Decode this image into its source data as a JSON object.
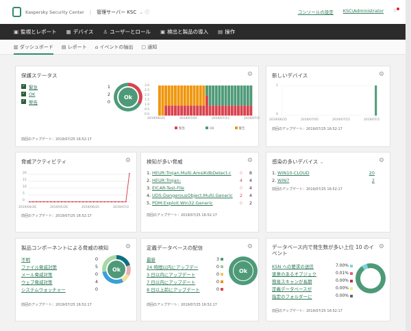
{
  "header": {
    "brand": "Kaspersky Security Center",
    "server": "管理サーバー KSC",
    "console_settings": "コンソールの設定",
    "user": "KSC\\Administrator"
  },
  "nav": [
    "監視とレポート",
    "デバイス",
    "ユーザーとロール",
    "検出と製品の導入",
    "操作"
  ],
  "subnav": [
    "ダッシュボード",
    "レポート",
    "イベントの抽出",
    "通知"
  ],
  "update_text": "前回のアップデート：2019/07/25 16:52:17",
  "ok": "Ok",
  "protection": {
    "title": "保護ステータス",
    "items": [
      {
        "label": "緊急",
        "value": "1"
      },
      {
        "label": "OK",
        "value": "2"
      },
      {
        "label": "警告",
        "value": "0"
      }
    ],
    "yticks": [
      "3.0",
      "2.5",
      "2.0",
      "1.5",
      "1.0",
      "0.5",
      "0.0"
    ],
    "xticks": [
      "2019/06/25",
      "2019/07/05",
      "2019/07/15",
      "2019/07/2"
    ],
    "legend": [
      "緊急",
      "OK",
      "警告"
    ],
    "colors": {
      "critical": "#d9434e",
      "ok": "#4e9a78",
      "warning": "#f0960e"
    }
  },
  "new_devices": {
    "title": "新しいデバイス",
    "yticks": [
      "1",
      "0"
    ],
    "xticks": [
      "2019/06/25",
      "2019/07/05",
      "2019/07/15",
      "2019/07/2"
    ],
    "values": [
      0,
      0,
      0,
      0,
      0,
      0,
      0,
      0,
      0,
      0,
      0,
      0,
      0,
      0,
      0,
      0,
      0,
      0,
      0,
      0,
      0,
      0,
      0,
      0,
      0,
      0,
      0,
      0,
      1
    ]
  },
  "threat_activity": {
    "title": "脅威アクティビティ",
    "yticks": [
      "20",
      "15",
      "10",
      "5",
      "0"
    ],
    "xticks": [
      "2019/04/26",
      "2019/05/26",
      "2019/06/25",
      "2019/07/2"
    ],
    "values": [
      0,
      0,
      0,
      0,
      0,
      0,
      0,
      0,
      0,
      0,
      0,
      0,
      0,
      0,
      0,
      0,
      0,
      0,
      0,
      0,
      0,
      0,
      0,
      0,
      0,
      0,
      0,
      0,
      21
    ]
  },
  "top_threats": {
    "title": "検知が多い脅威",
    "items": [
      {
        "n": "1.",
        "name": "HEUR:Trojan.Multi.AmsiKdbDetect.c",
        "a": "0",
        "b": "8"
      },
      {
        "n": "2.",
        "name": "HEUR:Trojan-",
        "a": "4",
        "b": "4"
      },
      {
        "n": "3.",
        "name": "EICAR-Test-File",
        "a": "0",
        "b": "4"
      },
      {
        "n": "4.",
        "name": "UDS:DangerousObject.Multi.Generic",
        "a": "2",
        "b": "4"
      },
      {
        "n": "5.",
        "name": "PDM:Exploit.Win32.Generic",
        "a": "0",
        "b": "2"
      }
    ]
  },
  "infected_devices": {
    "title": "感染の多いデバイス",
    "items": [
      {
        "n": "1.",
        "name": "WIN10-CLOUD",
        "v": "20"
      },
      {
        "n": "2.",
        "name": "WIN7",
        "v": "2"
      }
    ]
  },
  "components": {
    "title": "製品コンポーネントによる脅威の検知",
    "items": [
      {
        "label": "不明",
        "v": "0"
      },
      {
        "label": "ファイル脅威対策",
        "v": "5"
      },
      {
        "label": "メール脅威対策",
        "v": "0"
      },
      {
        "label": "ウェブ脅威対策",
        "v": "4"
      },
      {
        "label": "システムウォッチャー",
        "v": "0"
      }
    ]
  },
  "databases": {
    "title": "定義データベースの配信",
    "items": [
      {
        "label": "最新",
        "v": "3",
        "c": "#4e9a78"
      },
      {
        "label": "24 時間以内にアップデー",
        "v": "0",
        "c": "#8fd08f"
      },
      {
        "label": "3 日以内にアップデート",
        "v": "0",
        "c": "#f5c26b"
      },
      {
        "label": "7 日以内にアップデート",
        "v": "0",
        "c": "#f0960e"
      },
      {
        "label": "8 日以上前にアップデート",
        "v": "0",
        "c": "#d9434e"
      }
    ]
  },
  "top_events": {
    "title": "データベース内で発生数が多い上位 10 のイベント",
    "items": [
      {
        "label": "KSN への要求の送信",
        "v": "7.00%",
        "c": "#7fd3e0"
      },
      {
        "label": "害意のあるオブジェク",
        "v": "0.01%",
        "c": "#e0607a"
      },
      {
        "label": "簡易スキャンが長期",
        "v": "0.00%",
        "c": "#c0304a"
      },
      {
        "label": "定義データベースが",
        "v": "0.00%",
        "c": "#e8f070"
      },
      {
        "label": "指定のフォルダーに",
        "v": "0.00%",
        "c": "#5a6a70"
      }
    ]
  }
}
